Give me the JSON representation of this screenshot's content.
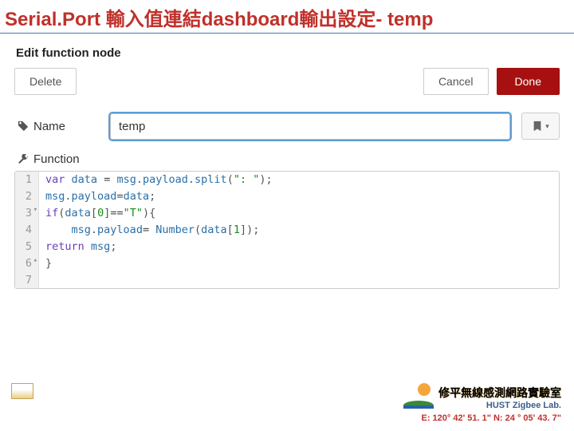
{
  "slide": {
    "title": "Serial.Port 輸入值連結dashboard輸出設定- temp"
  },
  "panel": {
    "header": "Edit function node"
  },
  "buttons": {
    "delete": "Delete",
    "cancel": "Cancel",
    "done": "Done"
  },
  "fields": {
    "name": {
      "label": "Name",
      "value": "temp"
    },
    "function": {
      "label": "Function"
    }
  },
  "code": {
    "lines": [
      {
        "n": "1",
        "fold": "",
        "tokens": [
          [
            "kw",
            "var"
          ],
          [
            "",
            ", "
          ],
          [
            "id",
            "data"
          ],
          [
            "",
            " "
          ],
          [
            "op",
            "="
          ],
          [
            "",
            " "
          ],
          [
            "id",
            "msg"
          ],
          [
            "punc",
            "."
          ],
          [
            "id",
            "payload"
          ],
          [
            "punc",
            "."
          ],
          [
            "id",
            "split"
          ],
          [
            "punc",
            "("
          ],
          [
            "str",
            "\": \""
          ],
          [
            "punc",
            ");"
          ]
        ]
      },
      {
        "n": "2",
        "fold": "",
        "tokens": [
          [
            "id",
            "msg"
          ],
          [
            "punc",
            "."
          ],
          [
            "id",
            "payload"
          ],
          [
            "op",
            "="
          ],
          [
            "id",
            "data"
          ],
          [
            "punc",
            ";"
          ]
        ]
      },
      {
        "n": "3",
        "fold": "▾",
        "tokens": [
          [
            "kw",
            "if"
          ],
          [
            "punc",
            "("
          ],
          [
            "id",
            "data"
          ],
          [
            "punc",
            "["
          ],
          [
            "num",
            "0"
          ],
          [
            "punc",
            "]"
          ],
          [
            "op",
            "=="
          ],
          [
            "str",
            "\"T\""
          ],
          [
            "punc",
            ")"
          ],
          [
            "punc",
            "{"
          ]
        ]
      },
      {
        "n": "4",
        "fold": "",
        "tokens": [
          [
            "",
            "    "
          ],
          [
            "id",
            "msg"
          ],
          [
            "punc",
            "."
          ],
          [
            "id",
            "payload"
          ],
          [
            "op",
            "="
          ],
          [
            "",
            " "
          ],
          [
            "id",
            "Number"
          ],
          [
            "punc",
            "("
          ],
          [
            "id",
            "data"
          ],
          [
            "punc",
            "["
          ],
          [
            "num",
            "1"
          ],
          [
            "punc",
            "]);"
          ]
        ]
      },
      {
        "n": "5",
        "fold": "",
        "tokens": [
          [
            "kw",
            "return"
          ],
          [
            "",
            " "
          ],
          [
            "id",
            "msg"
          ],
          [
            "punc",
            ";"
          ]
        ]
      },
      {
        "n": "6",
        "fold": "▴",
        "tokens": [
          [
            "punc",
            "}"
          ]
        ]
      },
      {
        "n": "7",
        "fold": "",
        "tokens": []
      }
    ]
  },
  "footer": {
    "lab_name_zh": "修平無線感測網路實驗室",
    "lab_name_en": "HUST Zigbee Lab.",
    "coords": "E: 120° 42' 51. 1\"  N: 24 ° 05' 43. 7\""
  }
}
